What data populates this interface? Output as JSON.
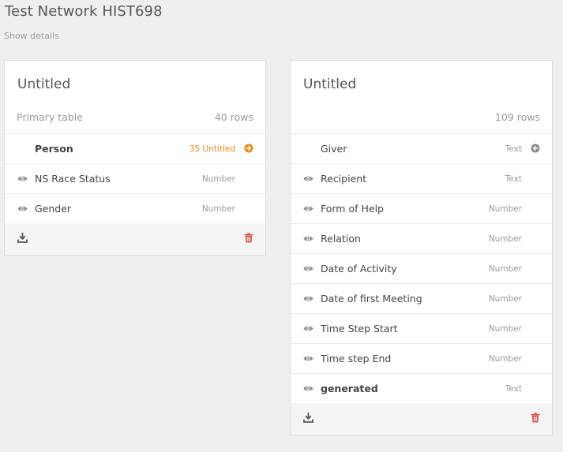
{
  "header": {
    "title": "Test Network HIST698",
    "show_details": "Show details"
  },
  "tables": [
    {
      "title": "Untitled",
      "subtitle": "Primary table",
      "rows": "40 rows",
      "fields": [
        {
          "name": "Person",
          "type": "35 Untitled",
          "bold": true,
          "icon": "arrow-circle-right-icon"
        },
        {
          "name": "NS Race Status",
          "type": "Number",
          "icon": "eye-icon"
        },
        {
          "name": "Gender",
          "type": "Number",
          "icon": "eye-icon"
        }
      ]
    },
    {
      "title": "Untitled",
      "subtitle": "",
      "rows": "109 rows",
      "fields": [
        {
          "name": "Giver",
          "type": "Text",
          "icon": "arrow-circle-left-icon"
        },
        {
          "name": "Recipient",
          "type": "Text",
          "icon": "eye-icon"
        },
        {
          "name": "Form of Help",
          "type": "Number",
          "icon": "eye-icon"
        },
        {
          "name": "Relation",
          "type": "Number",
          "icon": "eye-icon"
        },
        {
          "name": "Date of Activity",
          "type": "Number",
          "icon": "eye-icon"
        },
        {
          "name": "Date of first Meeting",
          "type": "Number",
          "icon": "eye-icon"
        },
        {
          "name": "Time Step Start",
          "type": "Number",
          "icon": "eye-icon"
        },
        {
          "name": "Time step End",
          "type": "Number",
          "icon": "eye-icon"
        },
        {
          "name": "generated",
          "type": "Text",
          "bold": true,
          "icon": "eye-icon"
        }
      ]
    }
  ],
  "colors": {
    "accent": "#e8861a",
    "delete": "#d9534f",
    "icon": "#8a8a8a"
  }
}
